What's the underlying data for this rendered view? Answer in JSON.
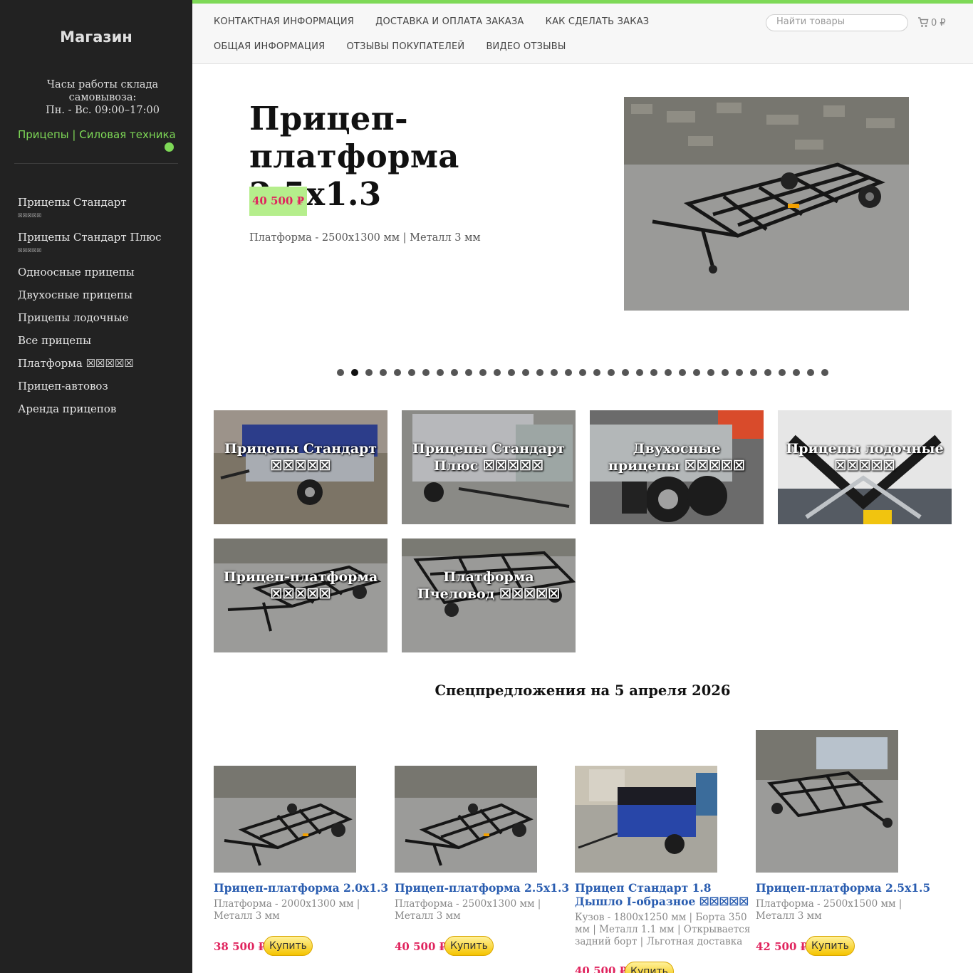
{
  "sidebar": {
    "brand": "Магазин",
    "hours_line1": "Часы работы склада самовывоза:",
    "hours_line2": "Пн. - Вс. 09:00–17:00",
    "category_link": "Прицепы | Силовая техника",
    "items": [
      {
        "label": "Прицепы Стандарт",
        "stars": "☒☒☒☒☒"
      },
      {
        "label": "Прицепы Стандарт Плюс",
        "stars": "☒☒☒☒☒"
      },
      {
        "label": "Одноосные прицепы",
        "stars": ""
      },
      {
        "label": "Двухосные прицепы",
        "stars": ""
      },
      {
        "label": "Прицепы лодочные",
        "stars": ""
      },
      {
        "label": "Все прицепы",
        "stars": ""
      },
      {
        "label": "Платформа ☒☒☒☒☒",
        "stars": ""
      },
      {
        "label": "Прицеп-автовоз",
        "stars": ""
      },
      {
        "label": "Аренда прицепов",
        "stars": ""
      }
    ]
  },
  "nav": {
    "links": [
      "КОНТАКТНАЯ ИНФОРМАЦИЯ",
      "ДОСТАВКА И ОПЛАТА ЗАКАЗА",
      "КАК СДЕЛАТЬ ЗАКАЗ",
      "ОБЩАЯ ИНФОРМАЦИЯ",
      "ОТЗЫВЫ ПОКУПАТЕЛЕЙ",
      "ВИДЕО ОТЗЫВЫ"
    ],
    "search_placeholder": "Найти товары",
    "cart_total": "0 ₽"
  },
  "hero": {
    "title": "Прицеп-платформа 2.5x1.3",
    "price": "40 500 ₽",
    "description": "Платформа - 2500x1300 мм | Металл 3 мм",
    "slide_count": 35,
    "active_slide": 2
  },
  "tiles": [
    {
      "caption": "Прицепы Стандарт ☒☒☒☒☒"
    },
    {
      "caption": "Прицепы Стандарт Плюс ☒☒☒☒☒"
    },
    {
      "caption": "Двухосные прицепы ☒☒☒☒☒"
    },
    {
      "caption": "Прицепы лодочные ☒☒☒☒☒"
    },
    {
      "caption": "Прицеп-платформа ☒☒☒☒☒"
    },
    {
      "caption": "Платформа Пчеловод ☒☒☒☒☒"
    }
  ],
  "special": {
    "title": "Спецпредложения на 5 апреля 2026",
    "buy_label": "Купить",
    "products": [
      {
        "name": "Прицеп-платформа 2.0x1.3",
        "desc": "Платформа - 2000x1300 мм | Металл 3 мм",
        "price": "38 500 ₽"
      },
      {
        "name": "Прицеп-платформа 2.5x1.3",
        "desc": "Платформа - 2500x1300 мм | Металл 3 мм",
        "price": "40 500 ₽"
      },
      {
        "name": "Прицеп Стандарт 1.8 Дышло I-образное ☒☒☒☒☒",
        "desc": "Кузов - 1800x1250 мм | Борта 350 мм | Металл 1.1 мм | Открывается задний борт | Льготная доставка",
        "price": "40 500 ₽"
      },
      {
        "name": "Прицеп-платформа 2.5x1.5",
        "desc": "Платформа - 2500x1500 мм | Металл 3 мм",
        "price": "42 500 ₽"
      }
    ]
  }
}
